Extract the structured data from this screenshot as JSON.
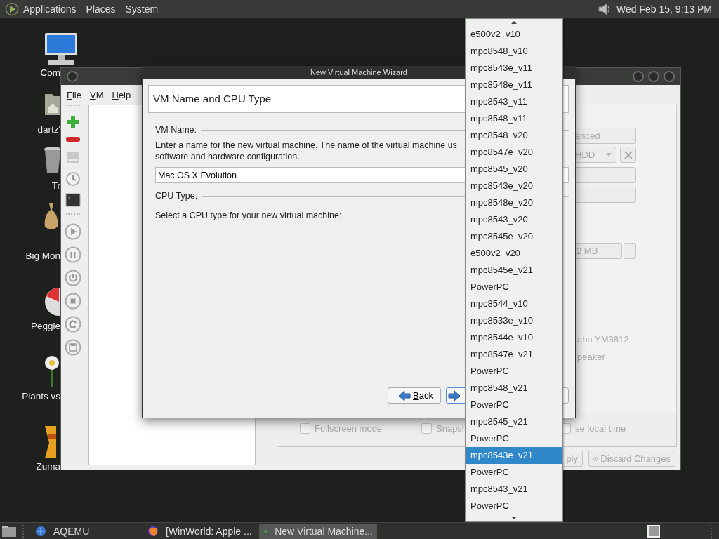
{
  "top_panel": {
    "menus": [
      "Applications",
      "Places",
      "System"
    ],
    "clock": "Wed Feb 15, 9:13 PM"
  },
  "desktop_icons": [
    {
      "label": "Com"
    },
    {
      "label": "dartz'"
    },
    {
      "label": "Tr"
    },
    {
      "label": "Big Mon"
    },
    {
      "label": "Peggle"
    },
    {
      "label": "Plants vs"
    },
    {
      "label": "Zuma"
    }
  ],
  "main_window": {
    "menus": [
      "File",
      "VM",
      "Help"
    ],
    "right_panel": {
      "advanced_button": "anced",
      "hdd_combo": "HDD",
      "memory_combo": "2 MB",
      "sound_card": "aha YM3812",
      "speaker": "peaker",
      "checkboxes": [
        {
          "label": "Fullscreen mode",
          "checked": false
        },
        {
          "label": "Snapsh",
          "checked": false
        },
        {
          "label": "se local time",
          "checked": false
        }
      ],
      "buttons": [
        "ply",
        "Discard Changes"
      ]
    }
  },
  "wizard": {
    "title": "New Virtual Machine Wizard",
    "header": "VM Name and CPU Type",
    "vm_name_label": "VM Name:",
    "vm_name_description": [
      "Enter a name for the new virtual machine. The name of the virtual machine us",
      "software and hardware configuration."
    ],
    "vm_name_value": "Mac OS X Evolution",
    "cpu_type_label": "CPU Type:",
    "cpu_type_description": "Select a CPU type for your new virtual machine:",
    "back_button": "Back"
  },
  "cpu_dropdown": {
    "items": [
      {
        "label": "e500v2_v10",
        "selected": false
      },
      {
        "label": "mpc8548_v10",
        "selected": false
      },
      {
        "label": "mpc8543e_v11",
        "selected": false
      },
      {
        "label": "mpc8548e_v11",
        "selected": false
      },
      {
        "label": "mpc8543_v11",
        "selected": false
      },
      {
        "label": "mpc8548_v11",
        "selected": false
      },
      {
        "label": "mpc8548_v20",
        "selected": false
      },
      {
        "label": "mpc8547e_v20",
        "selected": false
      },
      {
        "label": "mpc8545_v20",
        "selected": false
      },
      {
        "label": "mpc8543e_v20",
        "selected": false
      },
      {
        "label": "mpc8548e_v20",
        "selected": false
      },
      {
        "label": "mpc8543_v20",
        "selected": false
      },
      {
        "label": "mpc8545e_v20",
        "selected": false
      },
      {
        "label": "e500v2_v20",
        "selected": false
      },
      {
        "label": "mpc8545e_v21",
        "selected": false
      },
      {
        "label": "PowerPC",
        "selected": false
      },
      {
        "label": "mpc8544_v10",
        "selected": false
      },
      {
        "label": "mpc8533e_v10",
        "selected": false
      },
      {
        "label": "mpc8544e_v10",
        "selected": false
      },
      {
        "label": "mpc8547e_v21",
        "selected": false
      },
      {
        "label": "PowerPC",
        "selected": false
      },
      {
        "label": "mpc8548_v21",
        "selected": false
      },
      {
        "label": "PowerPC",
        "selected": false
      },
      {
        "label": "mpc8545_v21",
        "selected": false
      },
      {
        "label": "PowerPC",
        "selected": false
      },
      {
        "label": "mpc8543e_v21",
        "selected": true
      },
      {
        "label": "PowerPC",
        "selected": false
      },
      {
        "label": "mpc8543_v21",
        "selected": false
      },
      {
        "label": "PowerPC",
        "selected": false
      }
    ]
  },
  "taskbar": {
    "items": [
      {
        "label": "AQEMU",
        "active": false
      },
      {
        "label": "[WinWorld: Apple ...",
        "active": false
      },
      {
        "label": "New Virtual Machine...",
        "active": true
      }
    ]
  }
}
